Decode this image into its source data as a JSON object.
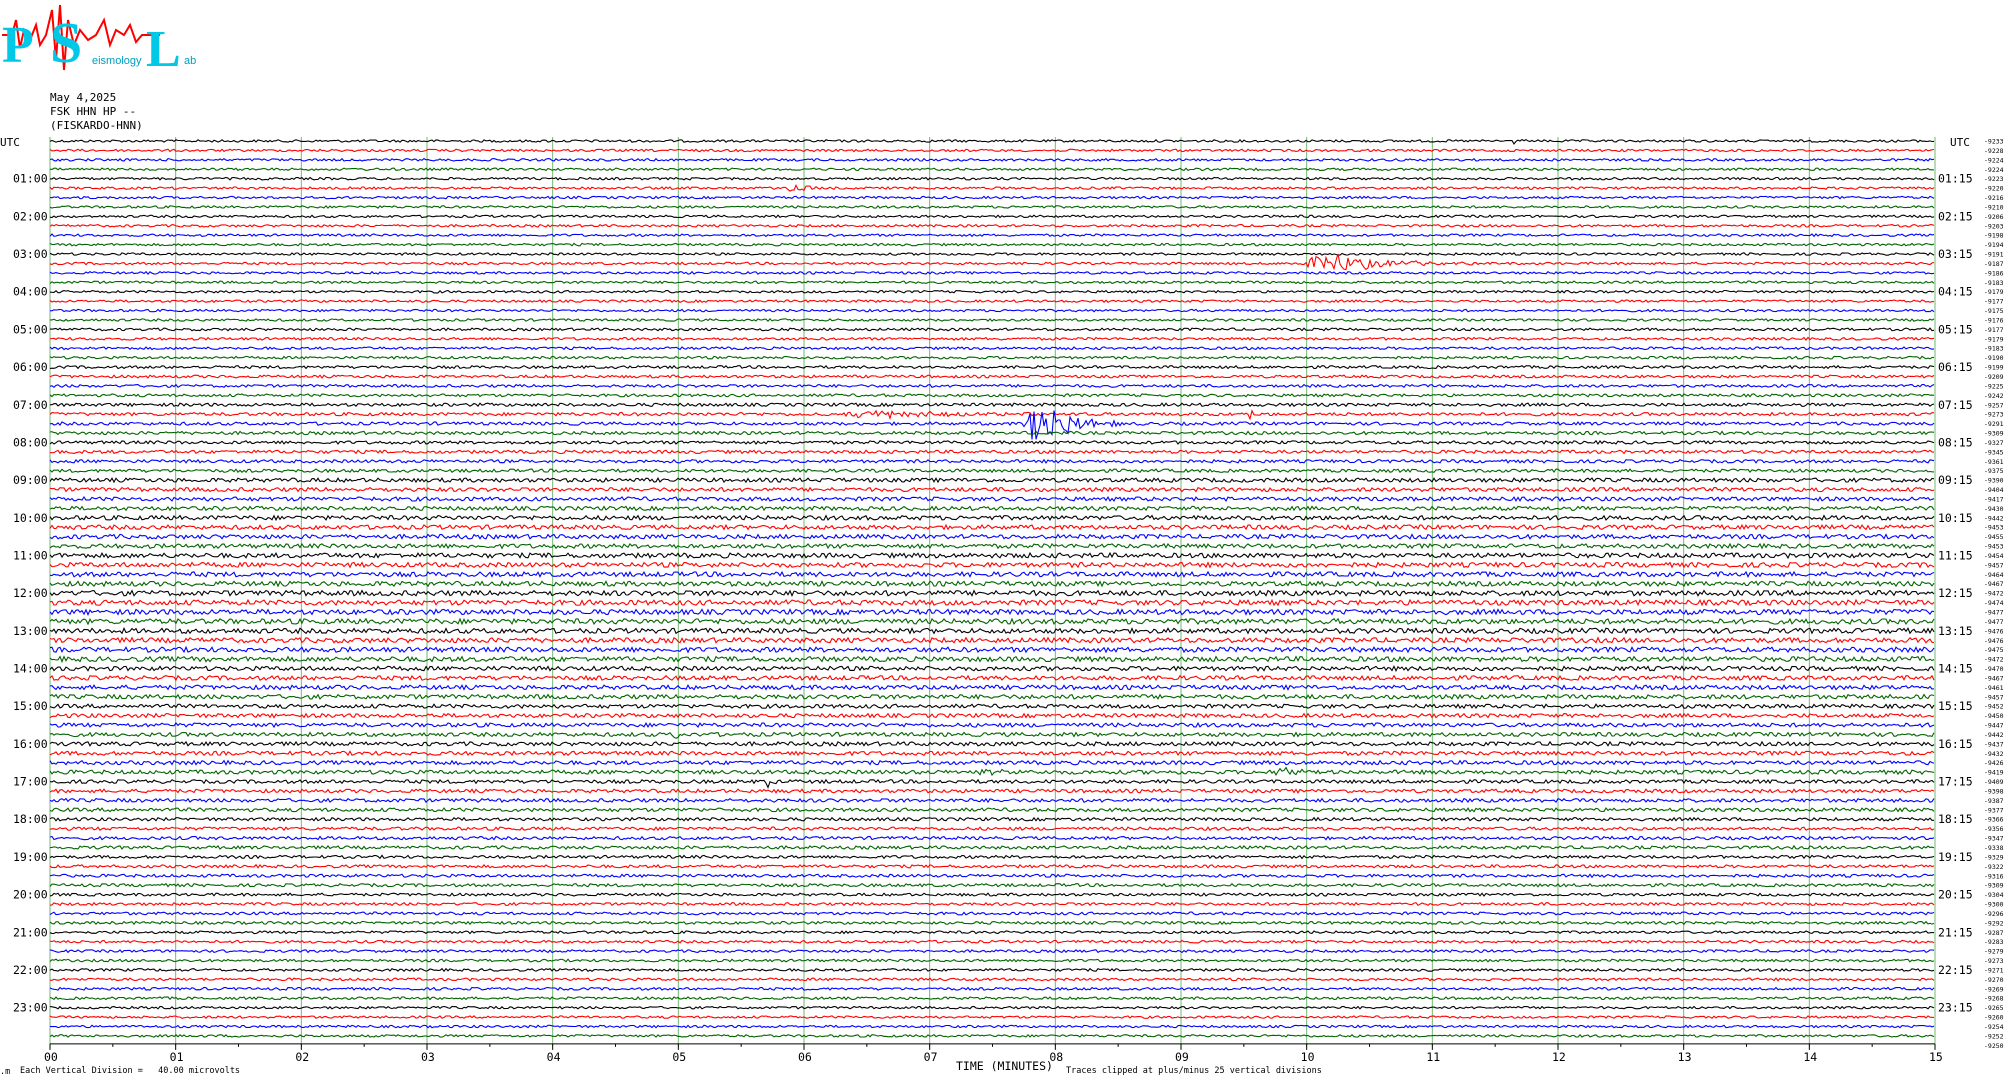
{
  "logo": {
    "letters": [
      "P",
      "S",
      "L"
    ],
    "subtitle_left": "eismology",
    "subtitle_right": "ab"
  },
  "header": {
    "date": "May 4,2025",
    "station": "FSK HHN HP --",
    "station_name": "(FISKARDO-HNN)"
  },
  "utc_label": "UTC",
  "x_axis": {
    "label": "TIME (MINUTES)",
    "ticks": [
      "00",
      "01",
      "02",
      "03",
      "04",
      "05",
      "06",
      "07",
      "08",
      "09",
      "10",
      "11",
      "12",
      "13",
      "14",
      "15"
    ],
    "range": [
      0,
      15
    ]
  },
  "footer": {
    "scale_note": "Each Vertical Division =   40.00 microvolts",
    "clip_note": "Traces clipped at plus/minus 25 vertical divisions",
    "corner_mark": ".m"
  },
  "colors": {
    "trace_cycle": [
      "#000000",
      "#ff0000",
      "#0000ff",
      "#006400"
    ],
    "grid": "#008000",
    "logo": "#00c8e6",
    "logo_wave": "#ff0000"
  },
  "chart_data": {
    "type": "line",
    "title": "",
    "xlabel": "TIME (MINUTES)",
    "ylabel": "",
    "traces_per_hour": 4,
    "trace_minutes": 15,
    "left_labels": [
      "01:00",
      "02:00",
      "03:00",
      "04:00",
      "05:00",
      "06:00",
      "07:00",
      "08:00",
      "09:00",
      "10:00",
      "11:00",
      "12:00",
      "13:00",
      "14:00",
      "15:00",
      "16:00",
      "17:00",
      "18:00",
      "19:00",
      "20:00",
      "21:00",
      "22:00",
      "23:00"
    ],
    "right_labels": [
      "01:15",
      "02:15",
      "03:15",
      "04:15",
      "05:15",
      "06:15",
      "07:15",
      "08:15",
      "09:15",
      "10:15",
      "11:15",
      "12:15",
      "13:15",
      "14:15",
      "15:15",
      "16:15",
      "17:15",
      "18:15",
      "19:15",
      "20:15",
      "21:15",
      "22:15",
      "23:15"
    ],
    "offsets": [
      "-9233",
      "-9228",
      "-9224",
      "-9224",
      "-9223",
      "-9220",
      "-9216",
      "-9210",
      "-9206",
      "-9203",
      "-9198",
      "-9194",
      "-9191",
      "-9187",
      "-9186",
      "-9183",
      "-9179",
      "-9177",
      "-9175",
      "-9176",
      "-9177",
      "-9179",
      "-9183",
      "-9190",
      "-9199",
      "-9209",
      "-9225",
      "-9242",
      "-9257",
      "-9273",
      "-9291",
      "-9309",
      "-9327",
      "-9345",
      "-9361",
      "-9375",
      "-9390",
      "-9404",
      "-9417",
      "-9430",
      "-9442",
      "-9453",
      "-9455",
      "-9453",
      "-9454",
      "-9457",
      "-9464",
      "-9467",
      "-9472",
      "-9474",
      "-9477",
      "-9477",
      "-9476",
      "-9476",
      "-9475",
      "-9472",
      "-9470",
      "-9467",
      "-9461",
      "-9457",
      "-9452",
      "-9450",
      "-9447",
      "-9442",
      "-9437",
      "-9432",
      "-9426",
      "-9419",
      "-9409",
      "-9398",
      "-9387",
      "-9377",
      "-9366",
      "-9356",
      "-9347",
      "-9338",
      "-9329",
      "-9322",
      "-9316",
      "-9309",
      "-9304",
      "-9300",
      "-9296",
      "-9292",
      "-9287",
      "-9283",
      "-9279",
      "-9273",
      "-9271",
      "-9270",
      "-9269",
      "-9268",
      "-9265",
      "-9260",
      "-9254",
      "-9252",
      "-9250"
    ],
    "noise_by_hour": [
      1.2,
      1.2,
      1.2,
      1.2,
      1.2,
      1.3,
      1.4,
      1.6,
      1.6,
      2.0,
      2.2,
      2.4,
      2.6,
      2.5,
      2.2,
      2.0,
      2.0,
      1.8,
      1.6,
      1.5,
      1.4,
      1.3,
      1.3,
      1.2
    ],
    "events": [
      {
        "trace": 0,
        "minute": 11.65,
        "amp": 3,
        "dur": 0.15
      },
      {
        "trace": 5,
        "minute": 5.9,
        "amp": 7,
        "dur": 0.2
      },
      {
        "trace": 13,
        "minute": 10.15,
        "amp": 12,
        "dur": 0.8
      },
      {
        "trace": 16,
        "minute": 1.3,
        "amp": 3,
        "dur": 0.05
      },
      {
        "trace": 29,
        "minute": 6.5,
        "amp": 4,
        "dur": 1.2
      },
      {
        "trace": 29,
        "minute": 9.55,
        "amp": 9,
        "dur": 0.05
      },
      {
        "trace": 30,
        "minute": 7.87,
        "amp": 25,
        "dur": 0.5
      },
      {
        "trace": 38,
        "minute": 9.25,
        "amp": 3,
        "dur": 0.1
      },
      {
        "trace": 63,
        "minute": 4.98,
        "amp": 6,
        "dur": 0.1
      },
      {
        "trace": 67,
        "minute": 7.4,
        "amp": 3,
        "dur": 0.3
      },
      {
        "trace": 67,
        "minute": 9.8,
        "amp": 6,
        "dur": 0.3
      },
      {
        "trace": 68,
        "minute": 5.72,
        "amp": 9,
        "dur": 0.08
      }
    ]
  }
}
